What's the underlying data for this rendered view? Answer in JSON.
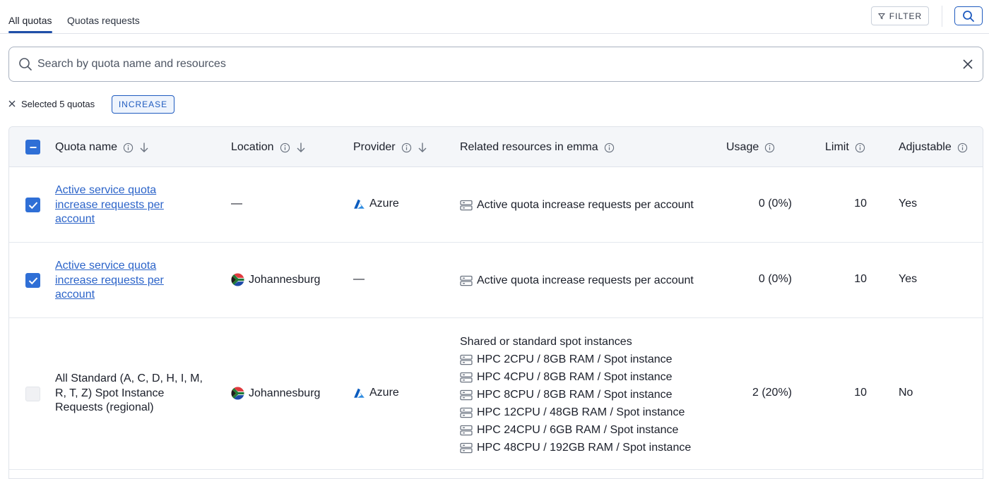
{
  "tabs": [
    {
      "label": "All quotas",
      "active": true
    },
    {
      "label": "Quotas requests",
      "active": false
    }
  ],
  "toolbar": {
    "filter_label": "FILTER"
  },
  "search": {
    "placeholder": "Search by quota name and resources",
    "value": ""
  },
  "selection": {
    "text": "Selected 5 quotas",
    "increase_label": "INCREASE"
  },
  "columns": {
    "quota_name": "Quota name",
    "location": "Location",
    "provider": "Provider",
    "related": "Related resources in emma",
    "usage": "Usage",
    "limit": "Limit",
    "adjustable": "Adjustable"
  },
  "rows": [
    {
      "checked": true,
      "name_lines": [
        "Active service quota",
        "increase requests per",
        "account"
      ],
      "name_is_link": true,
      "location": "—",
      "provider": "Azure",
      "resources_heading": "",
      "resources": [
        "Active quota increase requests per account"
      ],
      "usage": "0 (0%)",
      "limit": "10",
      "adjustable": "Yes"
    },
    {
      "checked": true,
      "name_lines": [
        "Active service quota",
        "increase requests per",
        "account"
      ],
      "name_is_link": true,
      "location": "Johannesburg",
      "provider": "—",
      "resources_heading": "",
      "resources": [
        "Active quota increase requests per account"
      ],
      "usage": "0 (0%)",
      "limit": "10",
      "adjustable": "Yes"
    },
    {
      "checked": false,
      "name_lines": [
        "All Standard (A, C, D, H, I, M,",
        "R, T, Z) Spot Instance",
        "Requests (regional)"
      ],
      "name_is_link": false,
      "location": "Johannesburg",
      "provider": "Azure",
      "resources_heading": "Shared or standard spot instances",
      "resources": [
        "HPC 2CPU / 8GB RAM / Spot instance",
        "HPC 4CPU / 8GB RAM / Spot instance",
        "HPC 8CPU / 8GB RAM / Spot instance",
        "HPC 12CPU / 48GB RAM / Spot instance",
        "HPC 24CPU / 6GB RAM / Spot instance",
        "HPC 48CPU / 192GB RAM / Spot instance"
      ],
      "usage": "2 (20%)",
      "limit": "10",
      "adjustable": "No"
    }
  ],
  "colors": {
    "accent": "#1f5bbf",
    "checkbox": "#2f6fd6",
    "link": "#2c64c9",
    "header_bg": "#f4f6f9"
  },
  "icons": [
    "filter-icon",
    "search-icon",
    "close-icon",
    "info-icon",
    "sort-down-icon",
    "azure-icon",
    "south-africa-flag-icon",
    "server-icon",
    "check-icon",
    "minus-icon"
  ]
}
